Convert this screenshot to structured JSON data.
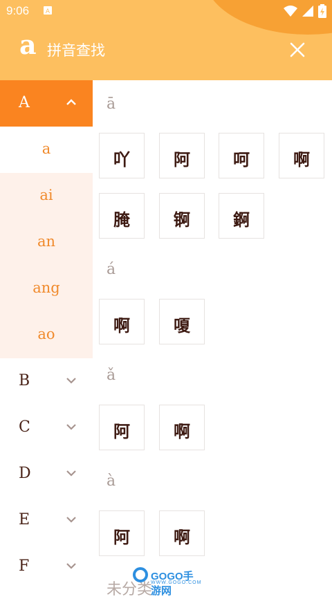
{
  "status": {
    "time": "9:06"
  },
  "header": {
    "logo": "a",
    "title": "拼音查找"
  },
  "sidebar": {
    "active_letter": "A",
    "selected_sub": "a",
    "subs": [
      "a",
      "ai",
      "an",
      "ang",
      "ao"
    ],
    "letters": [
      "B",
      "C",
      "D",
      "E",
      "F"
    ]
  },
  "sections": [
    {
      "pinyin": "ā",
      "chars": [
        "吖",
        "阿",
        "呵",
        "啊",
        "腌",
        "锕",
        "錒"
      ]
    },
    {
      "pinyin": "á",
      "chars": [
        "啊",
        "嗄"
      ]
    },
    {
      "pinyin": "ǎ",
      "chars": [
        "阿",
        "啊"
      ]
    },
    {
      "pinyin": "à",
      "chars": [
        "阿",
        "啊"
      ]
    }
  ],
  "partial_heading": "未分类",
  "watermark": {
    "brand": "GOGO手游网",
    "url": "WWW.GOGO.COM"
  },
  "colors": {
    "header": "#fdbf5f",
    "accent": "#fa8420",
    "sub_bg": "#fef1ea"
  }
}
